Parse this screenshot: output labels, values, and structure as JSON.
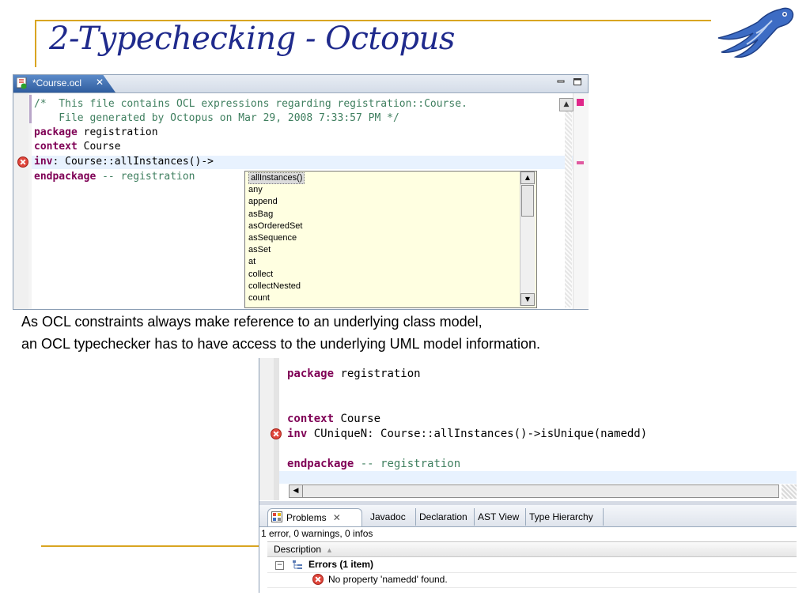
{
  "slide": {
    "title": "2-Typechecking - Octopus",
    "caption_line1": "As OCL constraints always make reference to an underlying class model,",
    "caption_line2": "an OCL typechecker has to have access to the underlying UML model information."
  },
  "colors": {
    "title": "#1f2a8c",
    "rule": "#d9a521",
    "keyword": "#7f0055",
    "comment": "#3f7f5f",
    "error": "#e0463b"
  },
  "editor1": {
    "tab_label": "*Course.ocl",
    "tab_close": "✕",
    "file_icon": "ocl-file-icon",
    "line1": "/*  This file contains OCL expressions regarding registration::Course.",
    "line2": "    File generated by Octopus on Mar 29, 2008 7:33:57 PM */",
    "line3_kw": "package",
    "line3_rest": " registration",
    "line4_kw": "context",
    "line4_rest": " Course",
    "line5_kw": "inv",
    "line5_rest": ": Course::allInstances()->",
    "line6_kw": "endpackage",
    "line6_rest": " -- registration",
    "completions": [
      "allInstances()",
      "any",
      "append",
      "asBag",
      "asOrderedSet",
      "asSequence",
      "asSet",
      "at",
      "collect",
      "collectNested",
      "count"
    ],
    "selected_completion": "allInstances()"
  },
  "editor2": {
    "line1_kw": "package",
    "line1_rest": " registration",
    "line2_kw": "context",
    "line2_rest": " Course",
    "line3_kw": "inv",
    "line3_rest": " CUniqueN: Course::allInstances()->isUnique(namedd)",
    "line4_kw": "endpackage",
    "line4_rest": " -- registration",
    "tabs": {
      "problems": "Problems",
      "problems_close": "✕",
      "javadoc": "Javadoc",
      "declaration": "Declaration",
      "ast_view": "AST View",
      "type_hierarchy": "Type Hierarchy"
    },
    "status": "1 error, 0 warnings, 0 infos",
    "column_description": "Description",
    "errors_group": "Errors (1 item)",
    "error_message": "No property 'namedd' found.",
    "toggle_symbol": "−"
  }
}
